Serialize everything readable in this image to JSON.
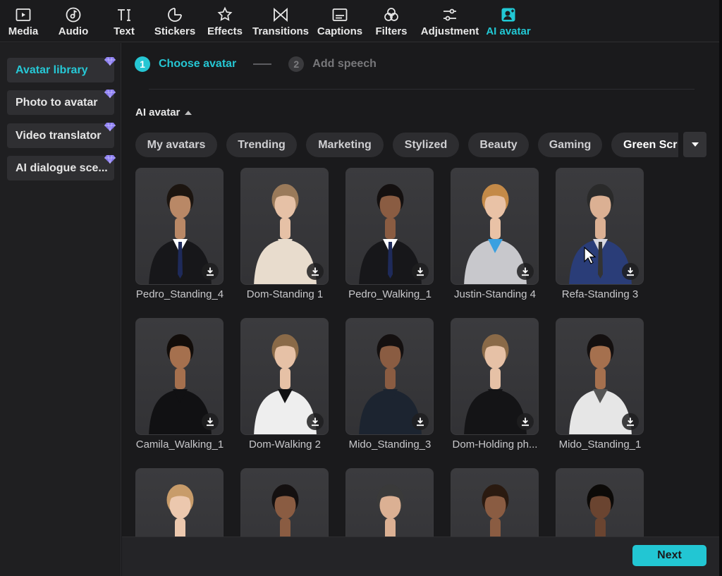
{
  "toolbar": {
    "items": [
      {
        "label": "Media",
        "icon": "media-icon"
      },
      {
        "label": "Audio",
        "icon": "audio-icon"
      },
      {
        "label": "Text",
        "icon": "text-icon"
      },
      {
        "label": "Stickers",
        "icon": "stickers-icon"
      },
      {
        "label": "Effects",
        "icon": "effects-icon"
      },
      {
        "label": "Transitions",
        "icon": "transitions-icon"
      },
      {
        "label": "Captions",
        "icon": "captions-icon"
      },
      {
        "label": "Filters",
        "icon": "filters-icon"
      },
      {
        "label": "Adjustment",
        "icon": "adjustment-icon"
      },
      {
        "label": "AI avatar",
        "icon": "ai-avatar-icon",
        "active": true
      }
    ]
  },
  "sidebar": {
    "items": [
      {
        "label": "Avatar library",
        "active": true,
        "premium": true
      },
      {
        "label": "Photo to avatar",
        "premium": true
      },
      {
        "label": "Video translator",
        "premium": true
      },
      {
        "label": "AI dialogue sce...",
        "premium": true
      }
    ]
  },
  "stepper": {
    "step1_number": "1",
    "step1_label": "Choose avatar",
    "step2_number": "2",
    "step2_label": "Add speech"
  },
  "section": {
    "title": "AI avatar"
  },
  "categories": [
    "My avatars",
    "Trending",
    "Marketing",
    "Stylized",
    "Beauty",
    "Gaming",
    "Green Scr"
  ],
  "avatars": [
    {
      "name": "Pedro_Standing_4"
    },
    {
      "name": "Dom-Standing 1"
    },
    {
      "name": "Pedro_Walking_1"
    },
    {
      "name": "Justin-Standing 4"
    },
    {
      "name": "Refa-Standing 3"
    },
    {
      "name": "Camila_Walking_1"
    },
    {
      "name": "Dom-Walking 2"
    },
    {
      "name": "Mido_Standing_3"
    },
    {
      "name": "Dom-Holding ph..."
    },
    {
      "name": "Mido_Standing_1"
    },
    {
      "name": ""
    },
    {
      "name": ""
    },
    {
      "name": ""
    },
    {
      "name": ""
    },
    {
      "name": ""
    }
  ],
  "footer": {
    "next_label": "Next"
  },
  "colors": {
    "accent": "#22c6d3",
    "background": "#1a1a1c",
    "card": "#333336",
    "premium_gem": "#8a7cf0"
  }
}
